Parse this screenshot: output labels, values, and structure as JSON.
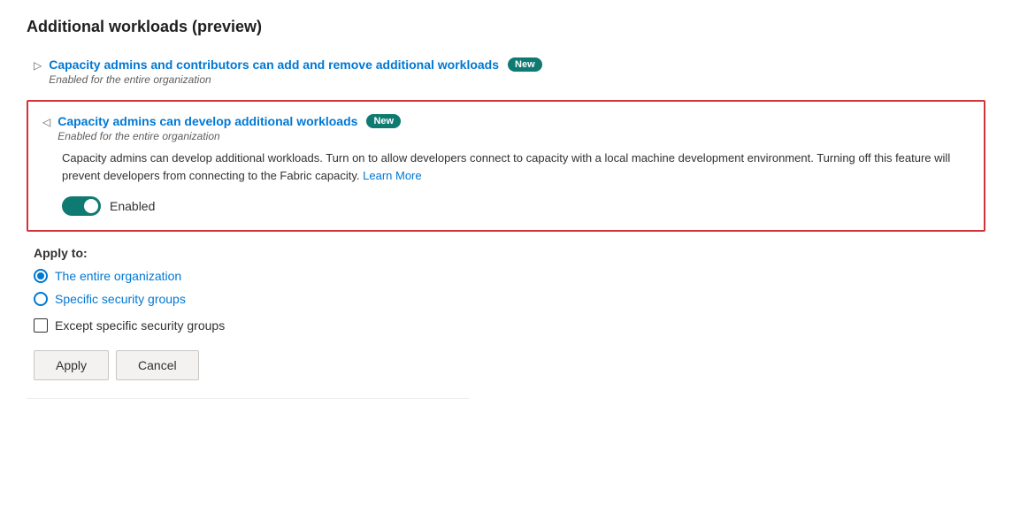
{
  "page": {
    "title": "Additional workloads (preview)"
  },
  "workloads": [
    {
      "id": "workload-1",
      "title": "Capacity admins and contributors can add and remove additional workloads",
      "badge": "New",
      "subtitle": "Enabled for the entire organization",
      "expanded": false,
      "chevron": "▷"
    },
    {
      "id": "workload-2",
      "title": "Capacity admins can develop additional workloads",
      "badge": "New",
      "subtitle": "Enabled for the entire organization",
      "expanded": true,
      "chevron": "◁",
      "description": "Capacity admins can develop additional workloads. Turn on to allow developers connect to capacity with a local machine development environment. Turning off this feature will prevent developers from connecting to the Fabric capacity.",
      "learn_more_label": "Learn More",
      "toggle_label": "Enabled",
      "toggle_on": true
    }
  ],
  "apply_to": {
    "label": "Apply to:",
    "options": [
      {
        "id": "opt-entire",
        "label": "The entire organization",
        "checked": true
      },
      {
        "id": "opt-specific",
        "label": "Specific security groups",
        "checked": false
      }
    ],
    "except_label": "Except specific security groups"
  },
  "buttons": {
    "apply_label": "Apply",
    "cancel_label": "Cancel"
  }
}
